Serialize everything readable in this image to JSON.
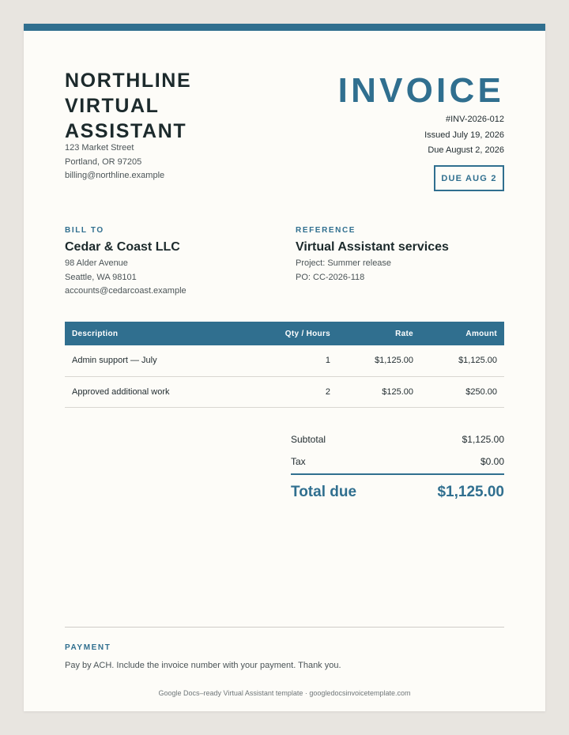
{
  "company": {
    "name_lines": [
      "NORTHLINE",
      "VIRTUAL",
      "ASSISTANT"
    ],
    "address_lines": [
      "123 Market Street",
      "Portland, OR 97205",
      "billing@northline.example"
    ]
  },
  "invoice": {
    "title": "INVOICE",
    "number": "#INV-2026-012",
    "issued": "Issued July 19, 2026",
    "due": "Due August 2, 2026",
    "due_badge": "DUE AUG 2"
  },
  "bill_to": {
    "label": "BILL TO",
    "name": "Cedar & Coast LLC",
    "lines": [
      "98 Alder Avenue",
      "Seattle, WA 98101",
      "accounts@cedarcoast.example"
    ]
  },
  "reference": {
    "label": "REFERENCE",
    "title": "Virtual Assistant services",
    "lines": [
      "Project: Summer release",
      "PO: CC-2026-118"
    ]
  },
  "items": {
    "headers": [
      "Description",
      "Qty / Hours",
      "Rate",
      "Amount"
    ],
    "rows": [
      [
        "Admin support — July",
        "1",
        "$1,125.00",
        "$1,125.00"
      ],
      [
        "Approved additional work",
        "2",
        "$125.00",
        "$250.00"
      ]
    ]
  },
  "totals": {
    "subtotal_label": "Subtotal",
    "subtotal_value": "$1,125.00",
    "tax_label": "Tax",
    "tax_value": "$0.00",
    "total_label": "Total due",
    "total_value": "$1,125.00"
  },
  "payment": {
    "label": "PAYMENT",
    "text": "Pay by ACH. Include the invoice number with your payment. Thank you."
  },
  "credit": "Google Docs–ready Virtual Assistant template · googledocsinvoicetemplate.com",
  "colors": {
    "accent": "#306f8f",
    "page_background": "#fdfcf8",
    "canvas_background": "#e8e5e0"
  }
}
